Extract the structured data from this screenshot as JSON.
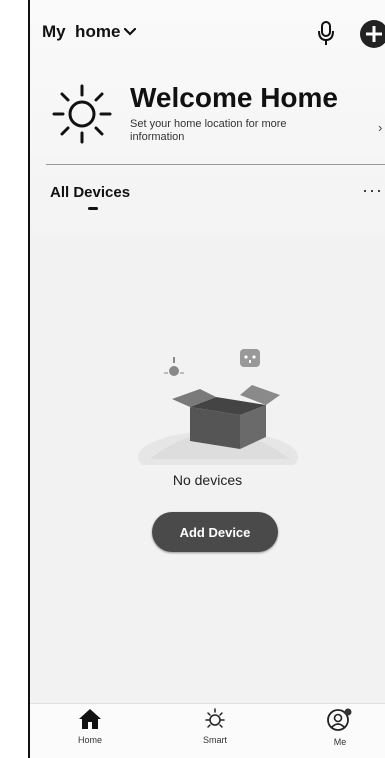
{
  "header": {
    "home_name": "My  home",
    "dropdown_icon": "chevron-down-icon",
    "mic_icon": "microphone-icon",
    "add_icon": "plus-circle-icon"
  },
  "welcome": {
    "icon": "sun-icon",
    "title": "Welcome Home",
    "subtitle": "Set your home location for more information",
    "chevron": "›"
  },
  "devices": {
    "tab_label": "All Devices",
    "more_icon": "···",
    "empty_text": "No devices",
    "add_button_label": "Add Device"
  },
  "tabbar": {
    "items": [
      {
        "label": "Home",
        "icon": "home-icon"
      },
      {
        "label": "Smart",
        "icon": "sun-outline-icon"
      },
      {
        "label": "Me",
        "icon": "user-icon"
      }
    ]
  }
}
